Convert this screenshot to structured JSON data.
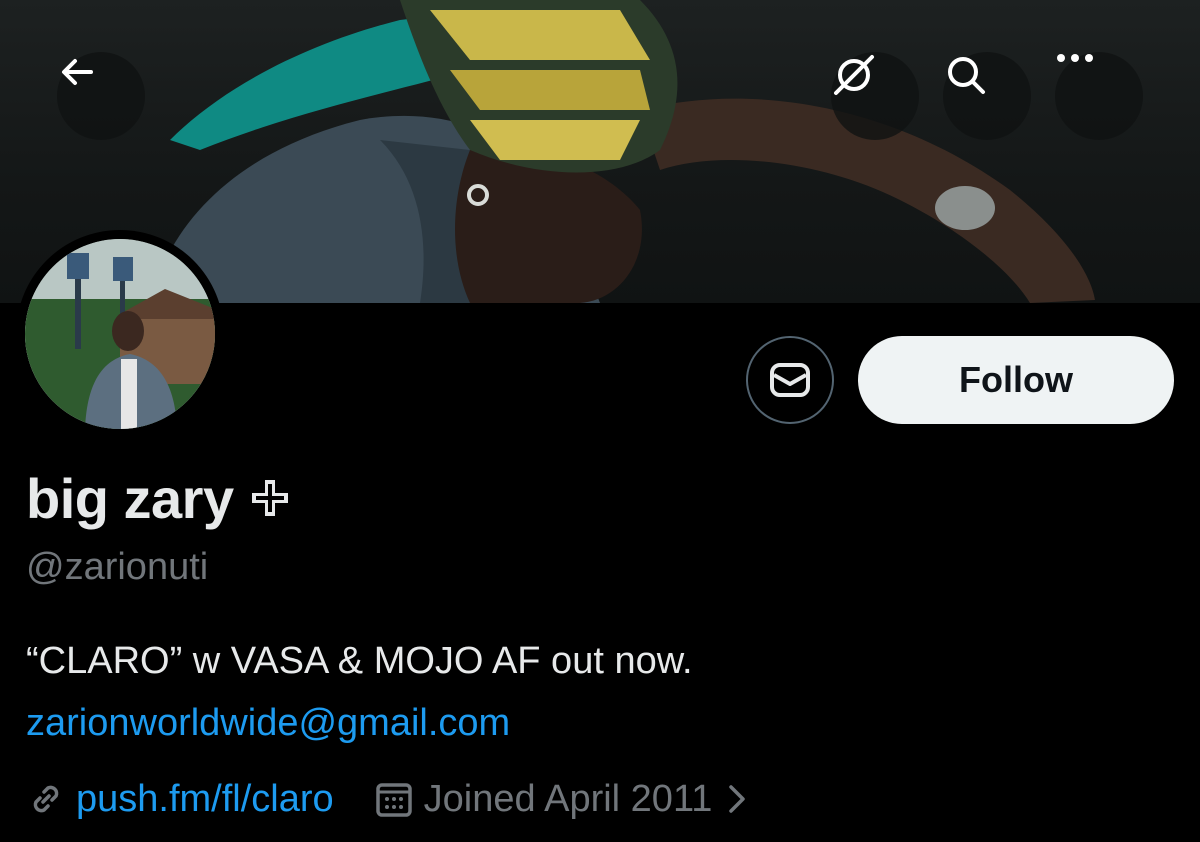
{
  "header": {
    "back_icon": "arrow-left-icon",
    "actions": [
      "grok-icon",
      "search-icon",
      "more-icon"
    ]
  },
  "profile": {
    "display_name": "big zary",
    "badge_icon": "plus-badge-icon",
    "handle": "@zarionuti",
    "bio": "“CLARO” w VASA & MOJO AF out now.",
    "email": "zarionworldwide@gmail.com",
    "website": "push.fm/fl/claro",
    "joined": "Joined April 2011"
  },
  "buttons": {
    "message_icon": "envelope-icon",
    "follow_label": "Follow"
  },
  "colors": {
    "link": "#1d9bf0",
    "muted": "#71767b",
    "text": "#e7e9ea",
    "follow_bg": "#eff3f4"
  }
}
